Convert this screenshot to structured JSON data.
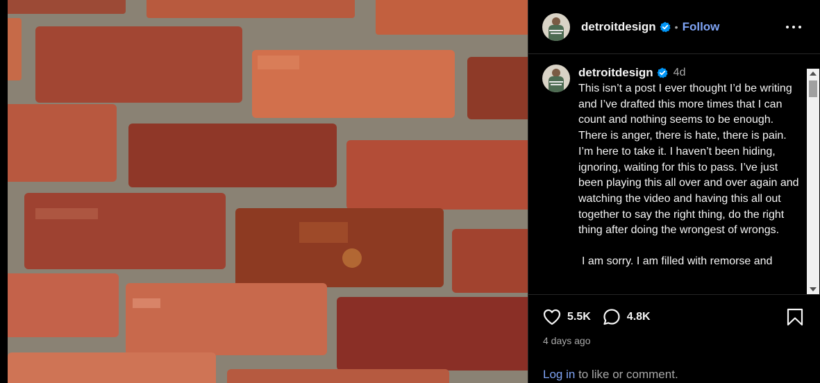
{
  "post": {
    "username": "detroitdesign",
    "follow_label": "Follow",
    "separator": "•"
  },
  "caption": {
    "username": "detroitdesign",
    "time": "4d",
    "paragraph1": "This isn’t a post I ever thought I’d be writing and I’ve drafted this more times that I can count and nothing seems to be enough.",
    "paragraph2": "There is anger, there is hate, there is pain. I’m here to take it. I haven’t been hiding, ignoring, waiting for this to pass. I’ve just been playing this all over and over again and watching the video and having this all out together to say the right thing, do the right thing after doing the wrongest of wrongs.",
    "paragraph3": "I am sorry. I am filled with remorse and"
  },
  "stats": {
    "likes": "5.5K",
    "comments": "4.8K",
    "posted_ago": "4 days ago"
  },
  "footer": {
    "login_link": "Log in",
    "login_text": "to like or comment."
  },
  "colors": {
    "accent": "#7fa4f5",
    "verified": "#0095f6",
    "background": "#000000",
    "muted": "#a8a8a8"
  },
  "icons": {
    "heart": "heart-icon",
    "comment": "comment-icon",
    "bookmark": "bookmark-icon",
    "more": "more-options-icon",
    "verified": "verified-badge-icon"
  }
}
